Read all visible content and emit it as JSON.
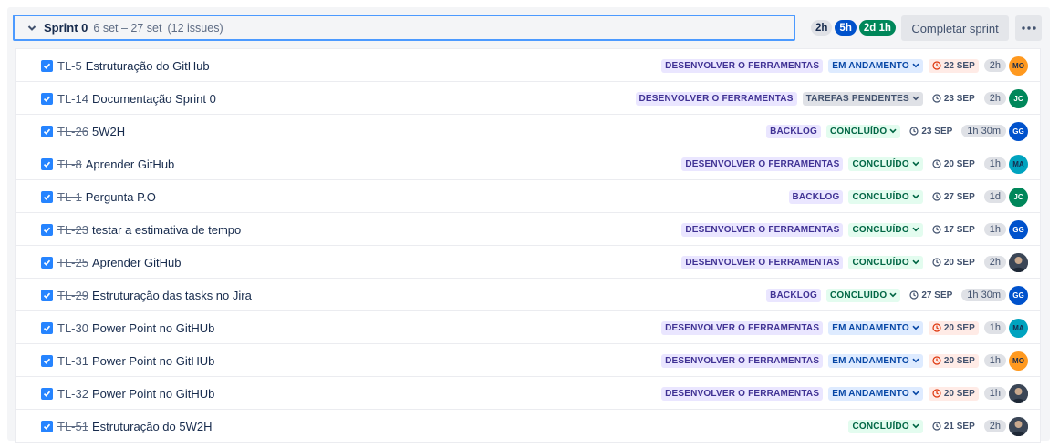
{
  "sprint": {
    "name": "Sprint 0",
    "dates": "6 set – 27 set",
    "count": "(12 issues)",
    "pills": [
      {
        "label": "2h",
        "style": "grey"
      },
      {
        "label": "5h",
        "style": "blue"
      },
      {
        "label": "2d 1h",
        "style": "green"
      }
    ],
    "complete_label": "Completar sprint",
    "more_icon": "more-horizontal-icon"
  },
  "issues": [
    {
      "key": "TL-5",
      "done_key": false,
      "summary": "Estruturação do GitHub",
      "epic": "DESENVOLVER O FERRAMENTAS",
      "status": "EM ANDAMENTO",
      "status_style": "prog",
      "due": "22 SEP",
      "overdue": true,
      "estimate": "2h",
      "assignee": "MO",
      "assignee_style": "MO"
    },
    {
      "key": "TL-14",
      "done_key": false,
      "summary": "Documentação Sprint 0",
      "epic": "DESENVOLVER O FERRAMENTAS",
      "status": "TAREFAS PENDENTES",
      "status_style": "todo",
      "due": "23 SEP",
      "overdue": false,
      "estimate": "2h",
      "assignee": "JC",
      "assignee_style": "JC"
    },
    {
      "key": "TL-26",
      "done_key": true,
      "summary": "5W2H",
      "epic": "BACKLOG",
      "status": "CONCLUÍDO",
      "status_style": "done",
      "due": "23 SEP",
      "overdue": false,
      "estimate": "1h 30m",
      "assignee": "GG",
      "assignee_style": "GG"
    },
    {
      "key": "TL-8",
      "done_key": true,
      "summary": "Aprender GitHub",
      "epic": "DESENVOLVER O FERRAMENTAS",
      "status": "CONCLUÍDO",
      "status_style": "done",
      "due": "20 SEP",
      "overdue": false,
      "estimate": "1h",
      "assignee": "MA",
      "assignee_style": "MA"
    },
    {
      "key": "TL-1",
      "done_key": true,
      "summary": "Pergunta P.O",
      "epic": "BACKLOG",
      "status": "CONCLUÍDO",
      "status_style": "done",
      "due": "27 SEP",
      "overdue": false,
      "estimate": "1d",
      "assignee": "JC",
      "assignee_style": "JC"
    },
    {
      "key": "TL-23",
      "done_key": true,
      "summary": "testar a estimativa de tempo",
      "epic": "DESENVOLVER O FERRAMENTAS",
      "status": "CONCLUÍDO",
      "status_style": "done",
      "due": "17 SEP",
      "overdue": false,
      "estimate": "1h",
      "assignee": "GG",
      "assignee_style": "GG"
    },
    {
      "key": "TL-25",
      "done_key": true,
      "summary": "Aprender GitHub",
      "epic": "DESENVOLVER O FERRAMENTAS",
      "status": "CONCLUÍDO",
      "status_style": "done",
      "due": "20 SEP",
      "overdue": false,
      "estimate": "2h",
      "assignee": "",
      "assignee_style": "photo"
    },
    {
      "key": "TL-29",
      "done_key": true,
      "summary": "Estruturação das tasks no Jira",
      "epic": "BACKLOG",
      "status": "CONCLUÍDO",
      "status_style": "done",
      "due": "27 SEP",
      "overdue": false,
      "estimate": "1h 30m",
      "assignee": "GG",
      "assignee_style": "GG"
    },
    {
      "key": "TL-30",
      "done_key": false,
      "summary": "Power Point no GitHUb",
      "epic": "DESENVOLVER O FERRAMENTAS",
      "status": "EM ANDAMENTO",
      "status_style": "prog",
      "due": "20 SEP",
      "overdue": true,
      "estimate": "1h",
      "assignee": "MA",
      "assignee_style": "MA"
    },
    {
      "key": "TL-31",
      "done_key": false,
      "summary": "Power Point no GitHUb",
      "epic": "DESENVOLVER O FERRAMENTAS",
      "status": "EM ANDAMENTO",
      "status_style": "prog",
      "due": "20 SEP",
      "overdue": true,
      "estimate": "1h",
      "assignee": "MO",
      "assignee_style": "MO"
    },
    {
      "key": "TL-32",
      "done_key": false,
      "summary": "Power Point no GitHUb",
      "epic": "DESENVOLVER O FERRAMENTAS",
      "status": "EM ANDAMENTO",
      "status_style": "prog",
      "due": "20 SEP",
      "overdue": true,
      "estimate": "1h",
      "assignee": "",
      "assignee_style": "photo"
    },
    {
      "key": "TL-51",
      "done_key": true,
      "summary": "Estruturação do 5W2H",
      "epic": "",
      "status": "CONCLUÍDO",
      "status_style": "done",
      "due": "21 SEP",
      "overdue": false,
      "estimate": "2h",
      "assignee": "",
      "assignee_style": "photo"
    }
  ]
}
